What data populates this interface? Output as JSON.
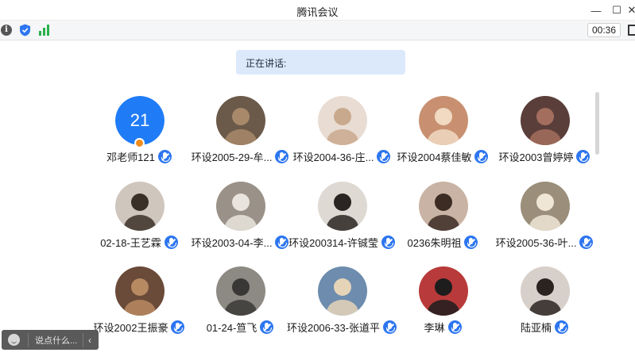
{
  "window": {
    "title": "腾讯会议",
    "controls": {
      "minimize": "—",
      "maximize": "☐",
      "close": "✕"
    }
  },
  "infobar": {
    "info_icon": "i",
    "timer": "00:36"
  },
  "speaking_label": "正在讲话:",
  "participants": [
    {
      "name": "邓老师121",
      "avatar_type": "initials",
      "avatar_text": "21",
      "avatar_color": "#1f7cf6",
      "is_host": true
    },
    {
      "name": "环设2005-29-牟...",
      "avatar_color": "#6b5a4a",
      "accent": "#a8896a"
    },
    {
      "name": "环设2004-36-庄...",
      "avatar_color": "#e8dcd3",
      "accent": "#c9a98d"
    },
    {
      "name": "环设2004蔡佳敏",
      "avatar_color": "#c89070",
      "accent": "#f1d9c2"
    },
    {
      "name": "环设2003曾婷婷",
      "avatar_color": "#5a3e3a",
      "accent": "#a46e5e"
    },
    {
      "name": "02-18-王艺霖",
      "avatar_color": "#cfc6bd",
      "accent": "#3b3028"
    },
    {
      "name": "环设2003-04-李...",
      "avatar_color": "#9a9188",
      "accent": "#e9e4dd"
    },
    {
      "name": "环设200314-许铖莹",
      "avatar_color": "#ded9d2",
      "accent": "#2a2522"
    },
    {
      "name": "0236朱明祖",
      "avatar_color": "#c9b3a4",
      "accent": "#3c2c24"
    },
    {
      "name": "环设2005-36-叶...",
      "avatar_color": "#9b8e7a",
      "accent": "#efe6d6"
    },
    {
      "name": "环设2002王振豪",
      "avatar_color": "#6a4a38",
      "accent": "#b88a62"
    },
    {
      "name": "01-24-笪飞",
      "avatar_color": "#8d8a84",
      "accent": "#3a3836"
    },
    {
      "name": "环设2006-33-张道平",
      "avatar_color": "#6d8cae",
      "accent": "#e6d4b8"
    },
    {
      "name": "李琳",
      "avatar_color": "#b93a3a",
      "accent": "#1d1d1d"
    },
    {
      "name": "陆亚楠",
      "avatar_color": "#d7cfc9",
      "accent": "#2b2320"
    }
  ],
  "chat": {
    "placeholder": "说点什么...",
    "collapse": "‹"
  },
  "icons": [
    "info-icon",
    "shield-icon",
    "signal-icon",
    "fullscreen-icon",
    "mic-icon",
    "emoji-icon",
    "collapse-icon"
  ]
}
